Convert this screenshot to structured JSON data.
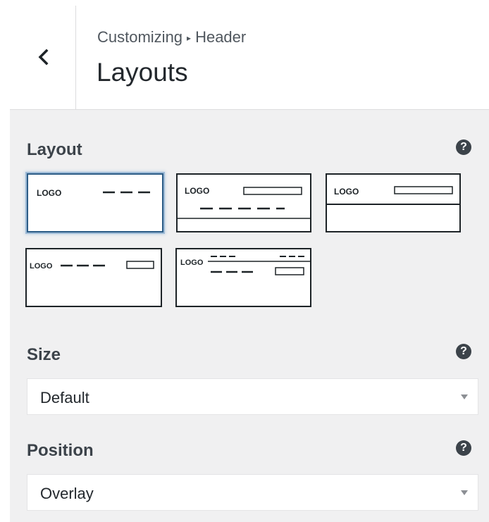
{
  "header": {
    "breadcrumb_root": "Customizing",
    "breadcrumb_separator": "▸",
    "breadcrumb_section": "Header",
    "title": "Layouts",
    "back_icon": "chevron-left-icon"
  },
  "layout": {
    "label": "Layout",
    "help_icon": "question-icon",
    "selected_index": 0,
    "options": [
      {
        "logo_text": "LOGO"
      },
      {
        "logo_text": "LOGO"
      },
      {
        "logo_text": "LOGO"
      },
      {
        "logo_text": "LOGO"
      },
      {
        "logo_text": "LOGO"
      }
    ]
  },
  "size": {
    "label": "Size",
    "value": "Default"
  },
  "position": {
    "label": "Position",
    "value": "Overlay"
  },
  "colors": {
    "panel_bg": "#f0f0f1",
    "selected_border": "#2c5c86",
    "text": "#3c434a"
  }
}
